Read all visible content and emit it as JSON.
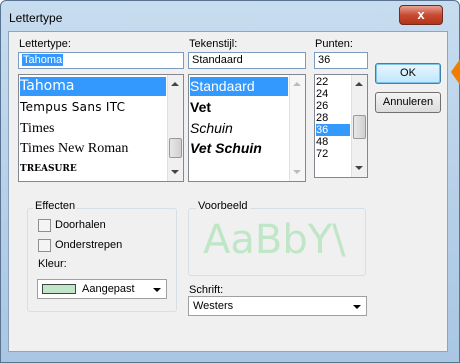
{
  "window": {
    "title": "Lettertype",
    "close_glyph": "x"
  },
  "font": {
    "label": "Lettertype:",
    "value": "Tahoma",
    "items": [
      "Tahoma",
      "Tempus Sans ITC",
      "Times",
      "Times New Roman",
      "TREASURE"
    ],
    "selected_index": 0
  },
  "style": {
    "label": "Tekenstijl:",
    "value": "Standaard",
    "items": [
      "Standaard",
      "Vet",
      "Schuin",
      "Vet Schuin"
    ],
    "selected_index": 0
  },
  "size": {
    "label": "Punten:",
    "value": "36",
    "items": [
      "22",
      "24",
      "26",
      "28",
      "36",
      "48",
      "72"
    ],
    "selected_index": 4
  },
  "buttons": {
    "ok": "OK",
    "cancel": "Annuleren"
  },
  "effects": {
    "label": "Effecten",
    "strikeout": "Doorhalen",
    "underline": "Onderstrepen",
    "color_label": "Kleur:",
    "color_value": "Aangepast",
    "color_swatch": "#bfe6c6"
  },
  "preview": {
    "label": "Voorbeeld",
    "sample": "AaBbY\\"
  },
  "script": {
    "label": "Schrift:",
    "value": "Westers"
  },
  "colors": {
    "accent_callout": "#f07c00",
    "selection": "#3399ff"
  }
}
